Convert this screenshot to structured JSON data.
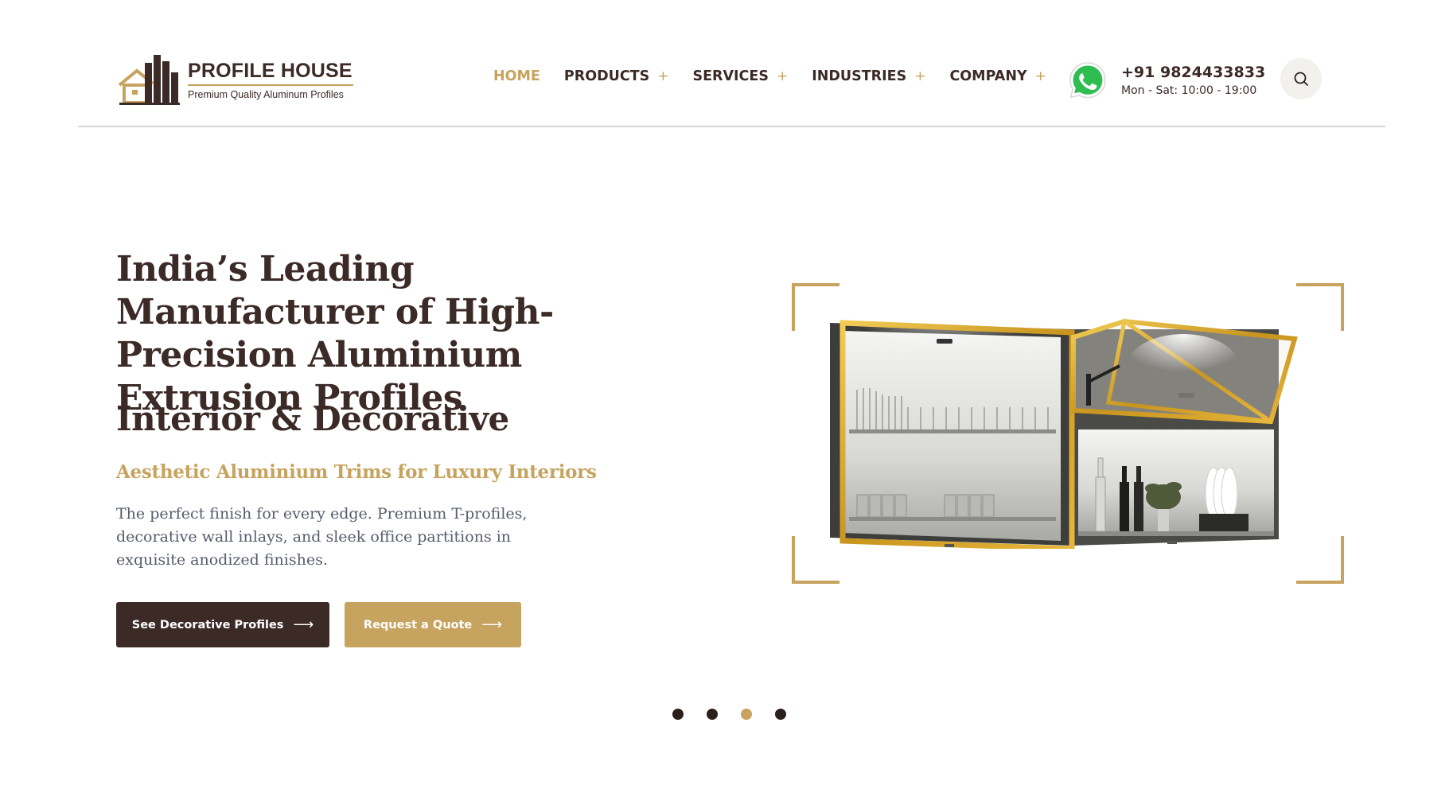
{
  "brand": {
    "name": "PROFILE HOUSE",
    "tagline": "Premium Quality Aluminum Profiles"
  },
  "nav": {
    "items": [
      {
        "label": "HOME",
        "active": true,
        "has_submenu": false
      },
      {
        "label": "PRODUCTS",
        "active": false,
        "has_submenu": true
      },
      {
        "label": "SERVICES",
        "active": false,
        "has_submenu": true
      },
      {
        "label": "INDUSTRIES",
        "active": false,
        "has_submenu": true
      },
      {
        "label": "COMPANY",
        "active": false,
        "has_submenu": true
      }
    ],
    "submenu_indicator": "+"
  },
  "contact": {
    "icon": "whatsapp-icon",
    "phone": "+91 9824433833",
    "hours": "Mon - Sat: 10:00 - 19:00"
  },
  "search": {
    "icon": "search-icon"
  },
  "hero": {
    "title": "India’s Leading Manufacturer of High-Precision Aluminium Extrusion Profiles",
    "subtitle": "Interior & Decorative",
    "tagline": "Aesthetic Aluminium Trims for Luxury Interiors",
    "description": "The perfect finish for every edge. Premium T-profiles, decorative wall inlays, and sleek office partitions in exquisite anodized finishes.",
    "primary_button": "See Decorative Profiles",
    "secondary_button": "Request a Quote",
    "button_arrow": "⟶",
    "image": "kitchen-cabinet-with-gold-aluminium-frames"
  },
  "slider": {
    "slide_count": 4,
    "active_index": 2
  },
  "colors": {
    "brand_dark": "#3b2a26",
    "accent_gold": "#c6a35e",
    "body_text": "#555d6b"
  }
}
